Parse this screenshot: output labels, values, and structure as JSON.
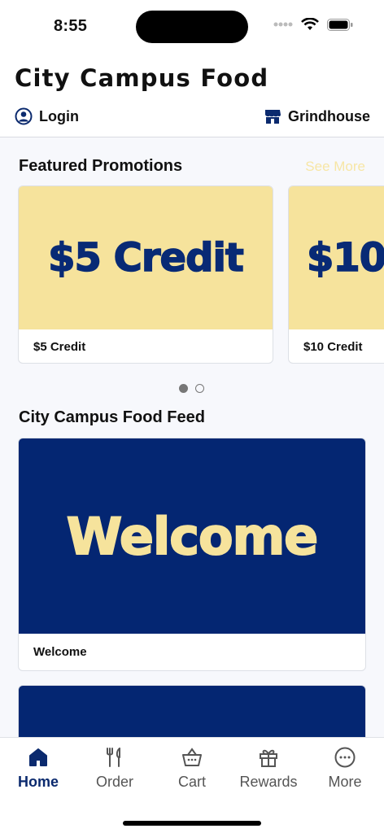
{
  "status_bar": {
    "time": "8:55"
  },
  "header": {
    "title": "City Campus Food",
    "login_label": "Login",
    "store_label": "Grindhouse"
  },
  "promotions": {
    "title": "Featured Promotions",
    "see_more": "See More",
    "cards": [
      {
        "image_text": "$5 Credit",
        "label": "$5 Credit"
      },
      {
        "image_text": "$10",
        "label": "$10 Credit"
      }
    ],
    "page_count": 2,
    "active_page": 1
  },
  "feed": {
    "title": "City Campus Food Feed",
    "cards": [
      {
        "image_text": "Welcome",
        "label": "Welcome"
      }
    ]
  },
  "tab_bar": {
    "tabs": [
      {
        "label": "Home",
        "icon": "home-icon",
        "active": true
      },
      {
        "label": "Order",
        "icon": "fork-knife-icon",
        "active": false
      },
      {
        "label": "Cart",
        "icon": "basket-icon",
        "active": false
      },
      {
        "label": "Rewards",
        "icon": "gift-icon",
        "active": false
      },
      {
        "label": "More",
        "icon": "more-icon",
        "active": false
      }
    ]
  },
  "colors": {
    "brand_navy": "#0b2a6e",
    "promo_yellow": "#f6e39c",
    "see_more_yellow": "#f7e6a5"
  }
}
